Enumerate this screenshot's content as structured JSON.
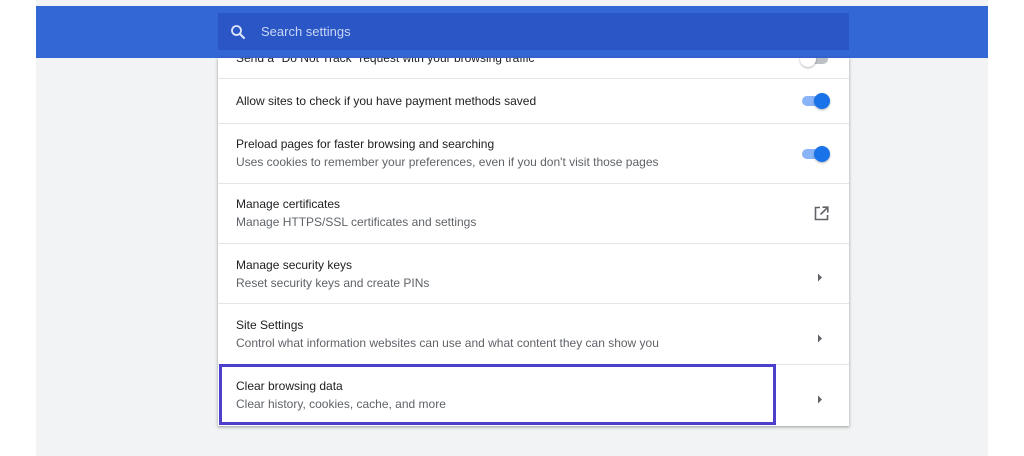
{
  "search": {
    "placeholder": "Search settings",
    "icon": "search-icon"
  },
  "rows": [
    {
      "primary": "Send a \"Do Not Track\" request with your browsing traffic",
      "control": "toggle",
      "state": "off"
    },
    {
      "primary": "Allow sites to check if you have payment methods saved",
      "control": "toggle",
      "state": "on"
    },
    {
      "primary": "Preload pages for faster browsing and searching",
      "secondary": "Uses cookies to remember your preferences, even if you don't visit those pages",
      "control": "toggle",
      "state": "on"
    },
    {
      "primary": "Manage certificates",
      "secondary": "Manage HTTPS/SSL certificates and settings",
      "control": "external-link-icon"
    },
    {
      "primary": "Manage security keys",
      "secondary": "Reset security keys and create PINs",
      "control": "arrow-right-icon"
    },
    {
      "primary": "Site Settings",
      "secondary": "Control what information websites can use and what content they can show you",
      "control": "arrow-right-icon"
    },
    {
      "primary": "Clear browsing data",
      "secondary": "Clear history, cookies, cache, and more",
      "control": "arrow-right-icon"
    }
  ],
  "colors": {
    "header": "#3367d6",
    "search_box": "#2a56c6",
    "toggle_on": "#1a73e8",
    "highlight": "#4c3fcb"
  }
}
